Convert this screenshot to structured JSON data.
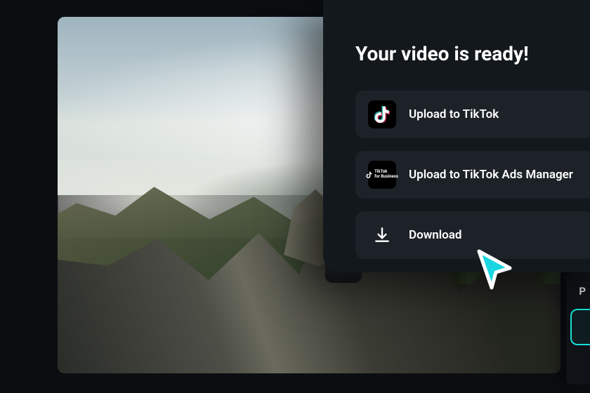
{
  "modal": {
    "title": "Your video is ready!",
    "options": [
      {
        "key": "tiktok",
        "label": "Upload to TikTok"
      },
      {
        "key": "tiktok_ads",
        "label": "Upload to TikTok Ads Manager"
      },
      {
        "key": "download",
        "label": "Download"
      }
    ]
  },
  "side_panel": {
    "label_fragment": "P"
  },
  "icons": {
    "tiktok": "tiktok-icon",
    "tiktok_business": "tiktok-business-icon",
    "download": "download-icon",
    "cursor": "cursor-icon"
  },
  "colors": {
    "modal_bg": "#13181d",
    "option_bg": "#1c2228",
    "accent_cyan": "#18e0d8",
    "cursor_fill": "#19d6e0",
    "cursor_stroke": "#ffffff"
  }
}
